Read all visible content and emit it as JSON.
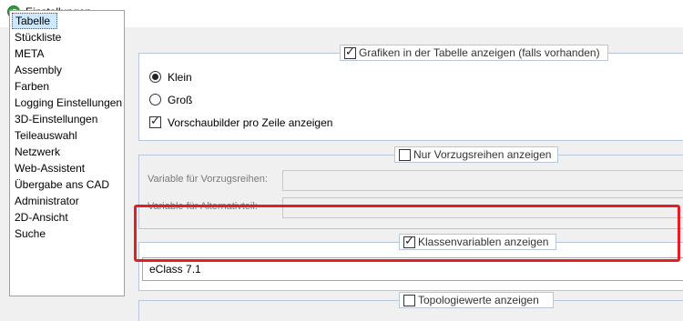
{
  "window": {
    "title": "Einstellungen",
    "icon": "settings-app-icon"
  },
  "sidebar": {
    "items": [
      {
        "label": "Tabelle",
        "selected": true
      },
      {
        "label": "Stückliste"
      },
      {
        "label": "META"
      },
      {
        "label": "Assembly"
      },
      {
        "label": "Farben"
      },
      {
        "label": "Logging Einstellungen"
      },
      {
        "label": "3D-Einstellungen"
      },
      {
        "label": "Teileauswahl"
      },
      {
        "label": "Netzwerk"
      },
      {
        "label": "Web-Assistent"
      },
      {
        "label": "Übergabe ans CAD"
      },
      {
        "label": "Administrator"
      },
      {
        "label": "2D-Ansicht"
      },
      {
        "label": "Suche"
      }
    ]
  },
  "grafiken": {
    "legend": "Grafiken in der Tabelle anzeigen (falls vorhanden)",
    "checked": true,
    "size_options": [
      {
        "label": "Klein",
        "selected": true
      },
      {
        "label": "Groß",
        "selected": false
      }
    ],
    "preview_label": "Vorschaubilder pro Zeile anzeigen",
    "preview_checked": true
  },
  "vorzugsreihen": {
    "legend": "Nur Vorzugsreihen anzeigen",
    "checked": false,
    "variable_label": "Variable für Vorzugsreihen:",
    "alternativ_label": "Variable für Alternativteil:"
  },
  "klassenvariablen": {
    "legend": "Klassenvariablen anzeigen",
    "checked": true,
    "value": "eClass 7.1"
  },
  "topologie": {
    "legend": "Topologiewerte anzeigen",
    "checked": false
  },
  "colors": {
    "highlight": "#e31e24",
    "selection": "#cce8ff",
    "group_border": "#b7c7db"
  }
}
